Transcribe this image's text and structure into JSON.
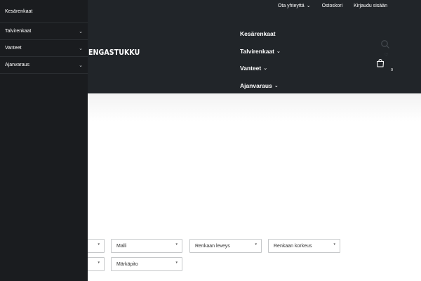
{
  "sidebar": {
    "items": [
      {
        "label": "Kesärenkaat",
        "has_chevron": false
      },
      {
        "label": "Talvirenkaat",
        "has_chevron": true
      },
      {
        "label": "Vanteet",
        "has_chevron": true
      },
      {
        "label": "Ajanvaraus",
        "has_chevron": true
      }
    ]
  },
  "top_links": {
    "contact": "Ota yhteyttä",
    "cart": "Ostoskori",
    "login": "Kirjaudu sisään"
  },
  "logo_text": "ENGASTUKKU",
  "main_nav": [
    {
      "label": "Kesärenkaat"
    },
    {
      "label": "Talvirenkaat"
    },
    {
      "label": "Vanteet"
    },
    {
      "label": "Ajanvaraus"
    }
  ],
  "cart_count": "0",
  "filters": {
    "model": "Malli",
    "tire_width": "Renkaan leveys",
    "tire_height": "Renkaan korkeus",
    "manufacturer": "Märkäpito"
  },
  "icons": {
    "chevron": "chevron-down-icon",
    "search": "search-icon",
    "user": "user-icon",
    "cart": "cart-icon"
  },
  "colors": {
    "header_bg": "#212529",
    "sidebar_bg": "#1a1c1f",
    "text_light": "#ffffff"
  }
}
